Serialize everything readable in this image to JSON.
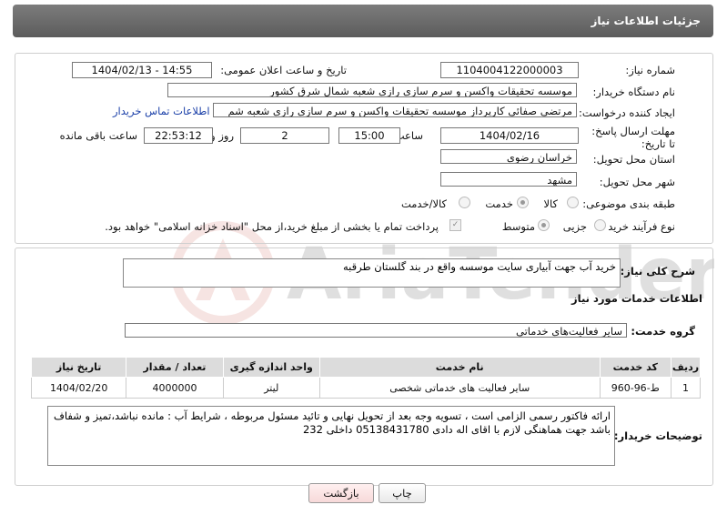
{
  "header": {
    "title": "جزئیات اطلاعات نیاز"
  },
  "form": {
    "need_number_label": "شماره نیاز:",
    "need_number": "1104004122000003",
    "announce_label": "تاریخ و ساعت اعلان عمومی:",
    "announce_value": "1404/02/13 - 14:55",
    "buyer_org_label": "نام دستگاه خریدار:",
    "buyer_org": "موسسه تحقیقات واکسن و سرم سازی رازی شعبه شمال شرق کشور",
    "creator_label": "ایجاد کننده درخواست:",
    "creator": "مرتضی صفائی کارپرداز موسسه تحقیقات واکسن و سرم سازی رازی شعبه شم",
    "contact_link": "اطلاعات تماس خریدار",
    "deadline_label": "مهلت ارسال پاسخ: تا تاریخ:",
    "deadline_date": "1404/02/16",
    "time_label": "ساعت",
    "deadline_time": "15:00",
    "days_value": "2",
    "days_label": "روز و",
    "remaining_time": "22:53:12",
    "remaining_label": "ساعت باقی مانده",
    "province_label": "استان محل تحویل:",
    "province": "خراسان رضوی",
    "city_label": "شهر محل تحویل:",
    "city": "مشهد",
    "category_label": "طبقه بندی موضوعی:",
    "category_options": [
      "کالا",
      "خدمت",
      "کالا/خدمت"
    ],
    "category_selected": "خدمت",
    "process_label": "نوع فرآیند خرید :",
    "process_options": [
      "جزیی",
      "متوسط"
    ],
    "process_selected": "متوسط",
    "payment_note": "پرداخت تمام یا بخشی از مبلغ خرید،از محل \"اسناد خزانه اسلامی\" خواهد بود."
  },
  "summary": {
    "label": "شرح کلی نیاز:",
    "value": "خرید آب جهت آبیاری سایت موسسه واقع در بند گلستان طرقبه"
  },
  "services": {
    "section_title": "اطلاعات خدمات مورد نیاز",
    "group_label": "گروه خدمت:",
    "group_value": "سایر فعالیت‌های خدماتی",
    "columns": [
      "ردیف",
      "کد خدمت",
      "نام خدمت",
      "واحد اندازه گیری",
      "تعداد / مقدار",
      "تاریخ نیاز"
    ],
    "rows": [
      [
        "1",
        "ط-96-960",
        "سایر فعالیت های خدماتی شخصی",
        "لیتر",
        "4000000",
        "1404/02/20"
      ]
    ]
  },
  "buyer_notes": {
    "label": "توضیحات خریدار:",
    "value": "ارائه فاکتور رسمی الزامی است ، تسویه وجه بعد از تحویل نهایی و تائید مسئول مربوطه ، شرایط آب : مانده نباشد،تمیز و شفاف باشد جهت هماهنگی لازم با اقای اله دادی 05138431780 داخلی 232"
  },
  "buttons": {
    "print": "چاپ",
    "back": "بازگشت"
  },
  "watermark": {
    "text": "AriaTender.neT"
  }
}
